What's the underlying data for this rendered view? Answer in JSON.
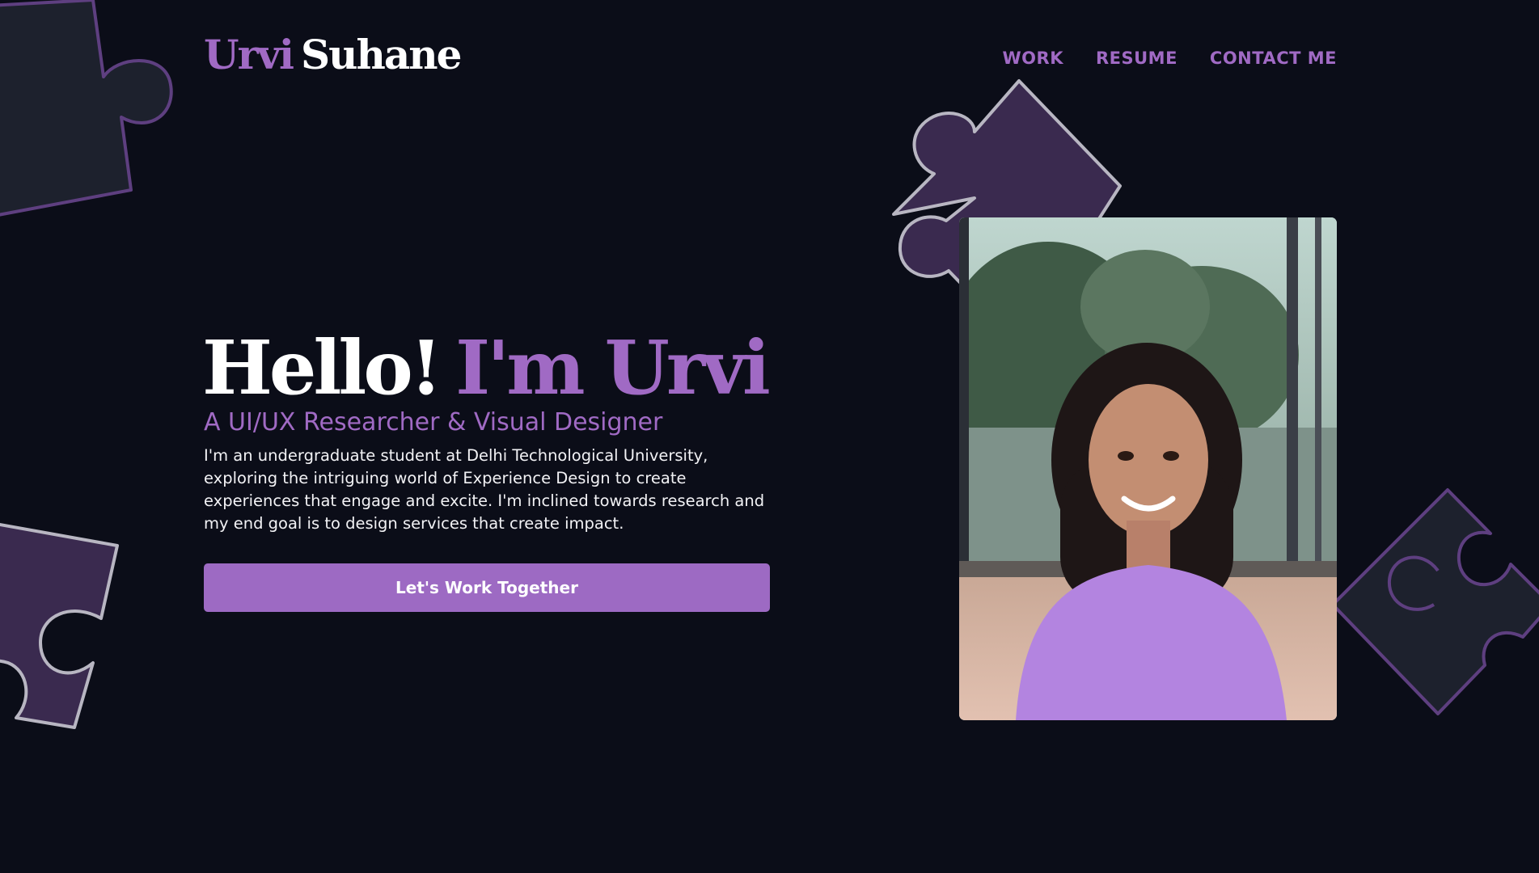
{
  "colors": {
    "background": "#0b0d18",
    "accent": "#a06ac4",
    "puzzle_purple": "#3a2a4f",
    "puzzle_dark": "#1d212d"
  },
  "header": {
    "logo_first": "Urvi",
    "logo_last": "Suhane",
    "nav": [
      {
        "label": "WORK"
      },
      {
        "label": "RESUME"
      },
      {
        "label": "CONTACT ME"
      }
    ]
  },
  "hero": {
    "greeting": "Hello!",
    "name": "I'm Urvi",
    "subtitle": "A UI/UX Researcher & Visual Designer",
    "bio": "I'm an undergraduate student at Delhi Technological University, exploring the intriguing world of Experience Design to create experiences that engage and excite. I'm inclined towards research and my end goal is to design services that create impact.",
    "cta_label": "Let's Work Together"
  },
  "decorations": [
    {
      "icon": "puzzle-piece-icon",
      "color": "#1d212d"
    },
    {
      "icon": "puzzle-piece-icon",
      "color": "#3a2a4f"
    },
    {
      "icon": "puzzle-piece-icon",
      "color": "#3a2a4f"
    },
    {
      "icon": "puzzle-piece-icon",
      "color": "#1d212d"
    }
  ]
}
